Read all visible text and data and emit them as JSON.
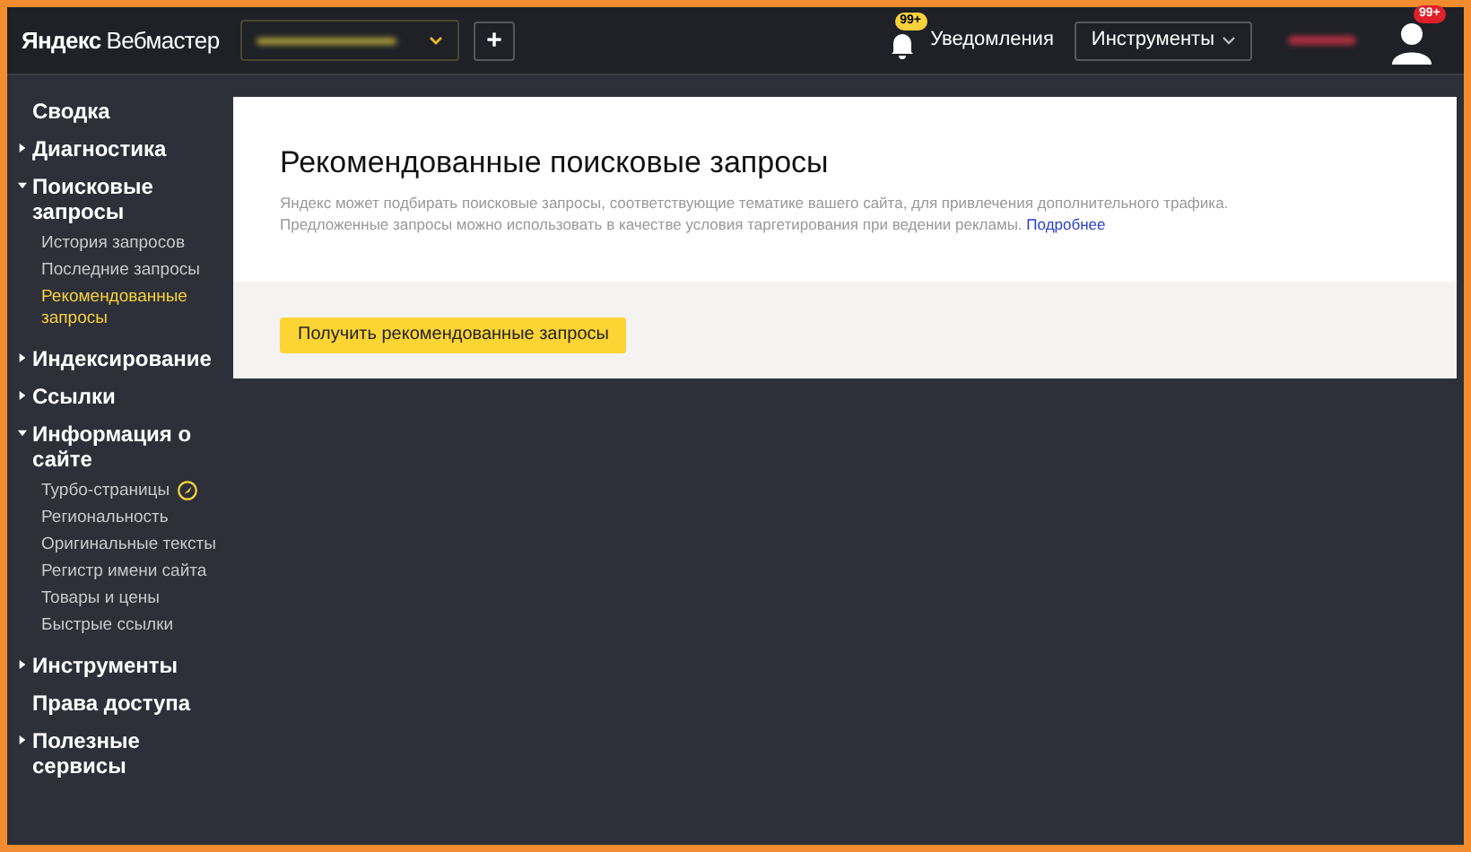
{
  "header": {
    "logo_bold": "Яндекс",
    "logo_rest": "Вебмастер",
    "add_button": "+",
    "notifications": {
      "badge": "99+",
      "label": "Уведомления"
    },
    "tools_button": "Инструменты",
    "avatar_badge": "99+"
  },
  "sidebar": {
    "items": [
      {
        "kind": "link",
        "label": "Сводка"
      },
      {
        "kind": "group",
        "label": "Диагностика",
        "expanded": false
      },
      {
        "kind": "group",
        "label": "Поисковые запросы",
        "expanded": true,
        "children": [
          {
            "label": "История запросов",
            "selected": false,
            "turbo": false
          },
          {
            "label": "Последние запросы",
            "selected": false,
            "turbo": false
          },
          {
            "label": "Рекомендованные запросы",
            "selected": true,
            "turbo": false
          }
        ]
      },
      {
        "kind": "group",
        "label": "Индексирование",
        "expanded": false
      },
      {
        "kind": "group",
        "label": "Ссылки",
        "expanded": false
      },
      {
        "kind": "group",
        "label": "Информация о сайте",
        "expanded": true,
        "children": [
          {
            "label": "Турбо-страницы",
            "selected": false,
            "turbo": true
          },
          {
            "label": "Региональность",
            "selected": false,
            "turbo": false
          },
          {
            "label": "Оригинальные тексты",
            "selected": false,
            "turbo": false
          },
          {
            "label": "Регистр имени сайта",
            "selected": false,
            "turbo": false
          },
          {
            "label": "Товары и цены",
            "selected": false,
            "turbo": false
          },
          {
            "label": "Быстрые ссылки",
            "selected": false,
            "turbo": false
          }
        ]
      },
      {
        "kind": "group",
        "label": "Инструменты",
        "expanded": false
      },
      {
        "kind": "link",
        "label": "Права доступа"
      },
      {
        "kind": "group",
        "label": "Полезные сервисы",
        "expanded": false
      }
    ]
  },
  "card": {
    "title": "Рекомендованные поисковые запросы",
    "description": "Яндекс может подбирать поисковые запросы, соответствующие тематике вашего сайта, для привлечения дополнительного трафика. Предложенные запросы можно использовать в качестве условия таргетирования при ведении рекламы.",
    "link": "Подробнее",
    "button": "Получить рекомендованные запросы"
  }
}
